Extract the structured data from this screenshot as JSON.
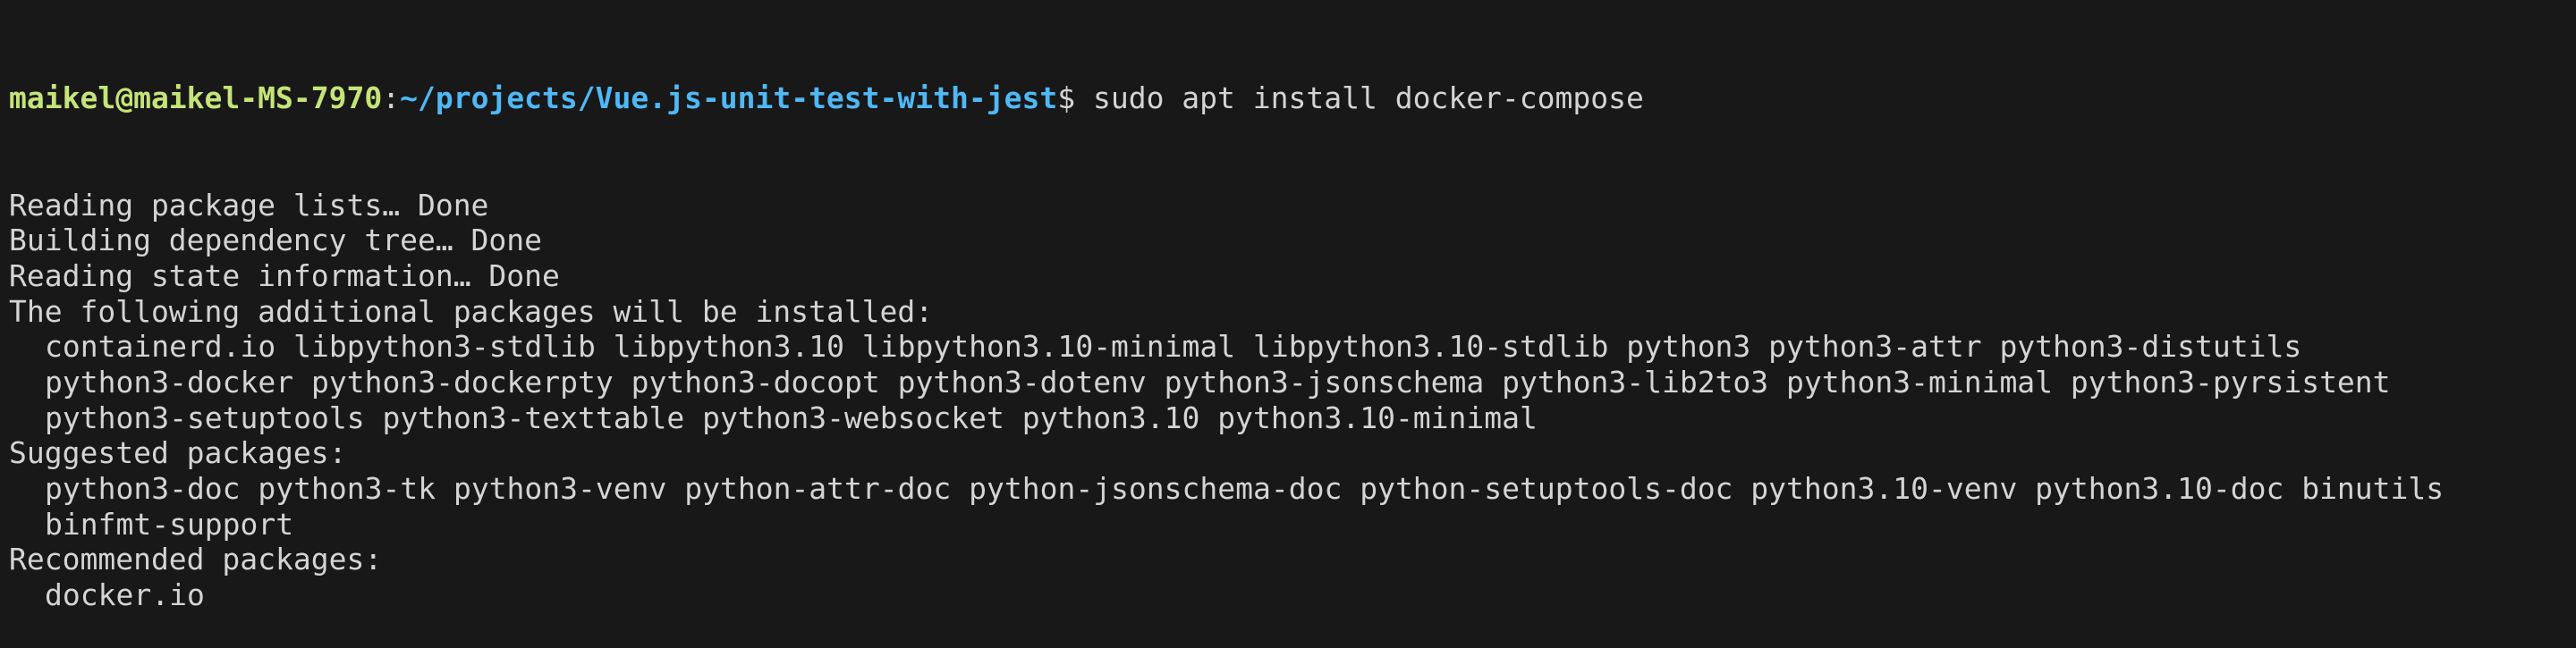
{
  "prompt": {
    "user_host": "maikel@maikel-MS-7970",
    "separator": ":",
    "path": "~/projects/Vue.js-unit-test-with-jest",
    "symbol": "$",
    "command": " sudo apt install docker-compose"
  },
  "colors": {
    "background": "#181818",
    "text": "#d4d4d4",
    "user": "#c5e478",
    "path": "#4fb8f5"
  },
  "output": [
    {
      "text": "Reading package lists… Done",
      "indent": false
    },
    {
      "text": "Building dependency tree… Done",
      "indent": false
    },
    {
      "text": "Reading state information… Done",
      "indent": false
    },
    {
      "text": "The following additional packages will be installed:",
      "indent": false
    },
    {
      "text": "containerd.io libpython3-stdlib libpython3.10 libpython3.10-minimal libpython3.10-stdlib python3 python3-attr python3-distutils",
      "indent": true
    },
    {
      "text": "python3-docker python3-dockerpty python3-docopt python3-dotenv python3-jsonschema python3-lib2to3 python3-minimal python3-pyrsistent",
      "indent": true
    },
    {
      "text": "python3-setuptools python3-texttable python3-websocket python3.10 python3.10-minimal",
      "indent": true
    },
    {
      "text": "Suggested packages:",
      "indent": false
    },
    {
      "text": "python3-doc python3-tk python3-venv python-attr-doc python-jsonschema-doc python-setuptools-doc python3.10-venv python3.10-doc binutils",
      "indent": true
    },
    {
      "text": "binfmt-support",
      "indent": true
    },
    {
      "text": "Recommended packages:",
      "indent": false
    },
    {
      "text": "docker.io",
      "indent": true
    }
  ]
}
